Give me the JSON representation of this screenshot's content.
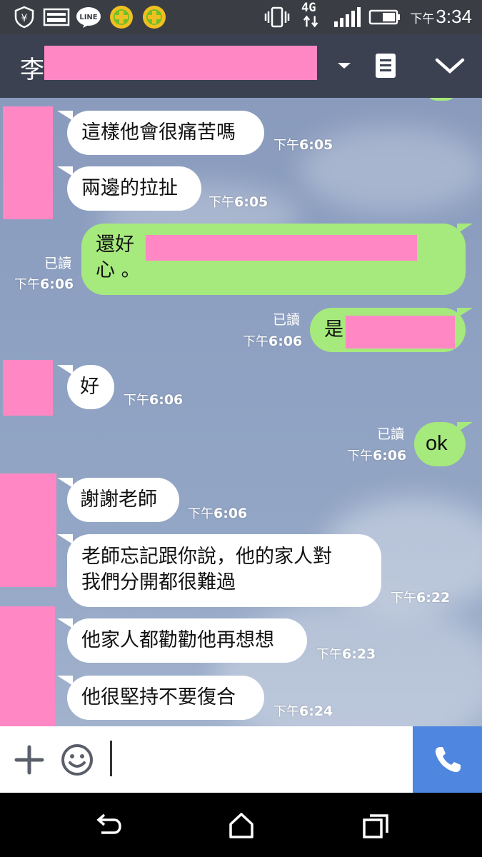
{
  "status_bar": {
    "ampm": "下午",
    "time": "3:34",
    "network": "4G",
    "icons": [
      "shield-icon",
      "gallery-icon",
      "line-icon",
      "game-icon",
      "game-icon",
      "vibrate-icon",
      "signal-icon",
      "battery-icon"
    ]
  },
  "header": {
    "chat_name": "李",
    "icons": [
      "dropdown-icon",
      "notes-icon",
      "collapse-icon"
    ]
  },
  "messages": [
    {
      "dir": "in",
      "text": "這樣他會很痛苦嗎",
      "ampm": "下午",
      "time": "6:05"
    },
    {
      "dir": "in",
      "text": "兩邊的拉扯",
      "ampm": "下午",
      "time": "6:05"
    },
    {
      "dir": "out",
      "line1": "還好",
      "line2": "心 。",
      "read": "已讀",
      "ampm": "下午",
      "time": "6:06"
    },
    {
      "dir": "out",
      "text": "是",
      "read": "已讀",
      "ampm": "下午",
      "time": "6:06"
    },
    {
      "dir": "in",
      "text": "好",
      "ampm": "下午",
      "time": "6:06"
    },
    {
      "dir": "out",
      "text": "ok",
      "read": "已讀",
      "ampm": "下午",
      "time": "6:06"
    },
    {
      "dir": "in",
      "text": "謝謝老師",
      "ampm": "下午",
      "time": "6:06"
    },
    {
      "dir": "in",
      "line1": "老師忘記跟你說，他的家人對",
      "line2": "我們分開都很難過",
      "ampm": "下午",
      "time": "6:22"
    },
    {
      "dir": "in",
      "text": "他家人都勸勸他再想想",
      "ampm": "下午",
      "time": "6:23"
    },
    {
      "dir": "in",
      "text": "他很堅持不要復合",
      "ampm": "下午",
      "time": "6:24"
    }
  ],
  "input_bar": {
    "icons": [
      "plus-icon",
      "emoji-icon",
      "phone-icon"
    ]
  },
  "nav_bar": {
    "icons": [
      "back-icon",
      "home-icon",
      "recents-icon"
    ]
  },
  "colors": {
    "redaction": "#ff88c4",
    "outgoing_bubble": "#a6e97d",
    "incoming_bubble": "#ffffff",
    "call_button": "#4f86e0",
    "header": "#3b4150"
  }
}
